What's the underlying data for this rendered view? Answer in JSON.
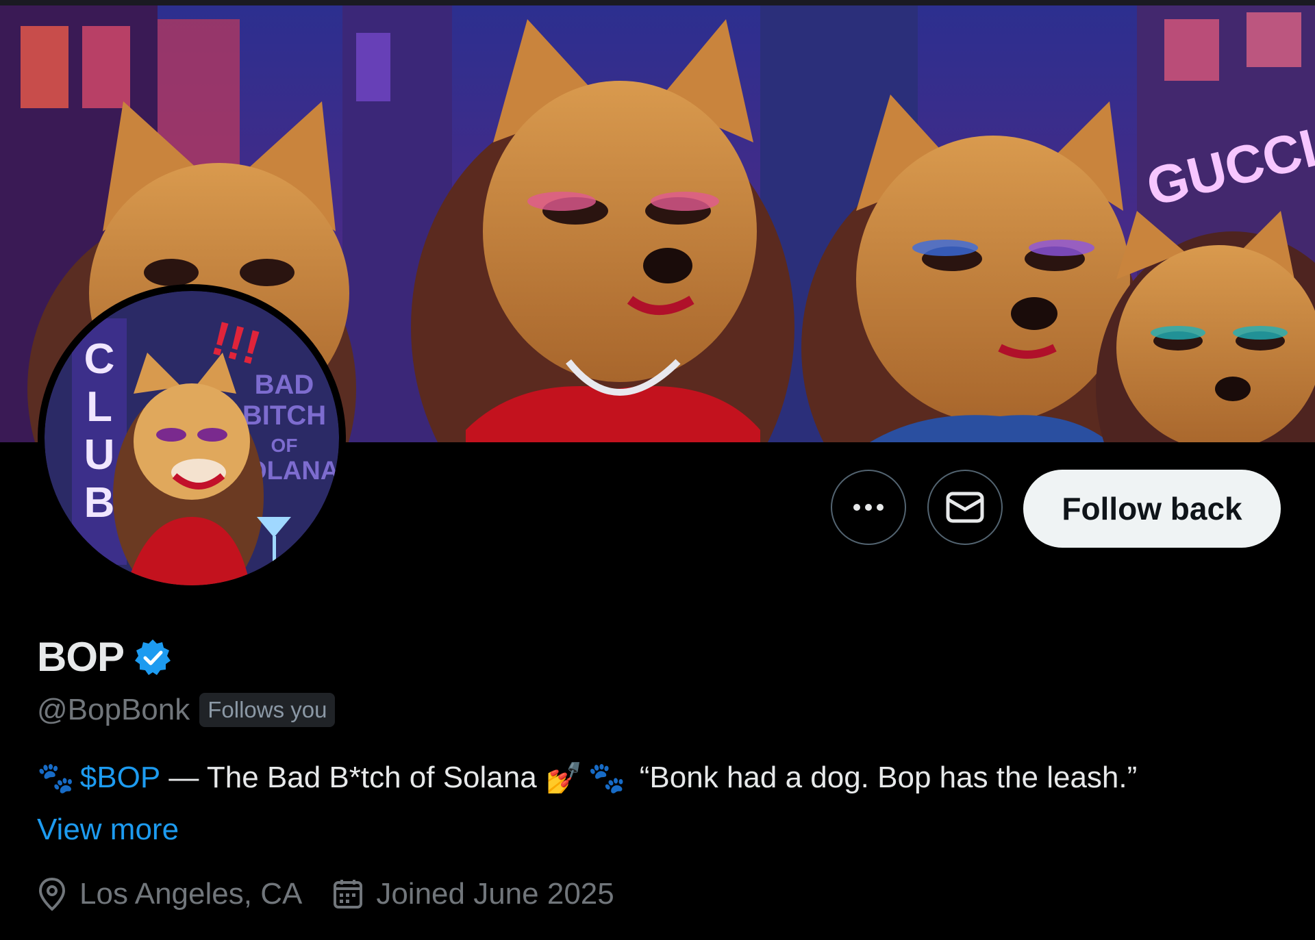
{
  "profile": {
    "display_name": "BOP",
    "handle": "@BopBonk",
    "follows_you": "Follows you",
    "bio": {
      "prefix_emoji": "🐾",
      "cashtag": "$BOP",
      "text": " — The Bad B*tch of Solana ",
      "emoji_2": "💅",
      "emoji_3": "🐾",
      "quote": " “Bonk had a dog. Bop has the leash.”"
    },
    "view_more": "View more",
    "location": "Los Angeles, CA",
    "joined": "Joined June 2025"
  },
  "actions": {
    "more_icon": "ellipsis-icon",
    "message_icon": "envelope-icon",
    "follow_back": "Follow back"
  },
  "banner": {
    "sign_text": "GUCCI"
  },
  "avatar": {
    "sign_club": "CLUB",
    "sign_text": "BAD BITCH OF SOLANA"
  },
  "colors": {
    "accent": "#1d9bf0",
    "verified": "#1d9bf0",
    "muted": "#71767b",
    "background": "#000000"
  }
}
